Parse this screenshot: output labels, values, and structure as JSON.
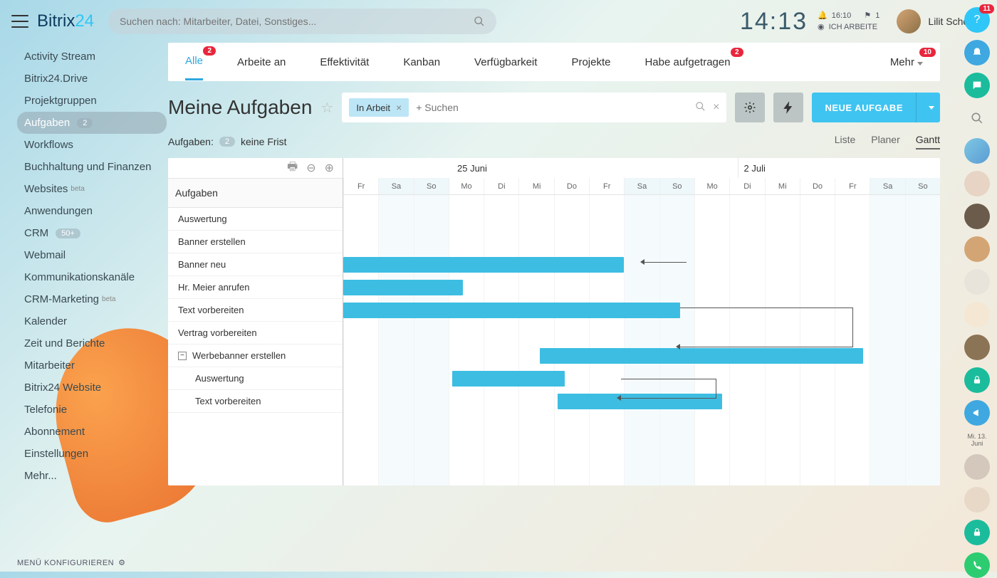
{
  "logo": {
    "part1": "Bitrix",
    "part2": "24"
  },
  "search": {
    "placeholder": "Suchen nach: Mitarbeiter, Datei, Sonstiges..."
  },
  "clock": "14:13",
  "mini": {
    "bell_time": "16:10",
    "flag_count": "1",
    "status": "ICH ARBEITE"
  },
  "user": {
    "name": "Lilit Schoo"
  },
  "sidebar": {
    "items": [
      {
        "label": "Activity Stream"
      },
      {
        "label": "Bitrix24.Drive"
      },
      {
        "label": "Projektgruppen"
      },
      {
        "label": "Aufgaben",
        "active": true,
        "pill": "2"
      },
      {
        "label": "Workflows"
      },
      {
        "label": "Buchhaltung und Finanzen"
      },
      {
        "label": "Websites",
        "beta": "beta"
      },
      {
        "label": "Anwendungen"
      },
      {
        "label": "CRM",
        "pill": "50+"
      },
      {
        "label": "Webmail"
      },
      {
        "label": "Kommunikationskanäle"
      },
      {
        "label": "CRM-Marketing",
        "beta": "beta"
      },
      {
        "label": "Kalender"
      },
      {
        "label": "Zeit und Berichte"
      },
      {
        "label": "Mitarbeiter"
      },
      {
        "label": "Bitrix24 Website"
      },
      {
        "label": "Telefonie"
      },
      {
        "label": "Abonnement"
      },
      {
        "label": "Einstellungen"
      },
      {
        "label": "Mehr..."
      }
    ],
    "footer": "MENÜ KONFIGURIEREN"
  },
  "tabs": {
    "items": [
      {
        "label": "Alle",
        "active": true,
        "badge": "2"
      },
      {
        "label": "Arbeite an"
      },
      {
        "label": "Effektivität"
      },
      {
        "label": "Kanban"
      },
      {
        "label": "Verfügbarkeit"
      },
      {
        "label": "Projekte"
      },
      {
        "label": "Habe aufgetragen",
        "badge": "2"
      }
    ],
    "more": {
      "label": "Mehr",
      "badge": "10"
    }
  },
  "page": {
    "title": "Meine Aufgaben"
  },
  "filter": {
    "chip": "In Arbeit",
    "placeholder": "+ Suchen"
  },
  "new_task_button": "NEUE AUFGABE",
  "sub": {
    "prefix": "Aufgaben:",
    "count": "2",
    "suffix": "keine Frist"
  },
  "views": {
    "list": "Liste",
    "planner": "Planer",
    "gantt": "Gantt"
  },
  "gantt": {
    "header": "Aufgaben",
    "months": [
      {
        "label": "25 Juni",
        "span": 10
      },
      {
        "label": "2 Juli",
        "span": 7
      }
    ],
    "days": [
      "Fr",
      "Sa",
      "So",
      "Mo",
      "Di",
      "Mi",
      "Do",
      "Fr",
      "Sa",
      "So",
      "Mo",
      "Di",
      "Mi",
      "Do",
      "Fr",
      "Sa",
      "So"
    ],
    "weekend": [
      1,
      2,
      8,
      9,
      15,
      16
    ],
    "tasks": [
      {
        "label": "Auswertung"
      },
      {
        "label": "Banner erstellen"
      },
      {
        "label": "Banner neu",
        "bar": {
          "start": 0,
          "span": 8
        }
      },
      {
        "label": "Hr. Meier anrufen",
        "bar": {
          "start": 0,
          "span": 3.4
        }
      },
      {
        "label": "Text vorbereiten",
        "bar": {
          "start": 0,
          "span": 9.6
        }
      },
      {
        "label": "Vertrag vorbereiten"
      },
      {
        "label": "Werbebanner erstellen",
        "expandable": true,
        "bar": {
          "start": 5.6,
          "span": 9.2
        }
      },
      {
        "label": "Auswertung",
        "sub": true,
        "bar": {
          "start": 3.1,
          "span": 3.2
        }
      },
      {
        "label": "Text vorbereiten",
        "sub": true,
        "bar": {
          "start": 6.1,
          "span": 4.7
        }
      }
    ]
  },
  "rail": {
    "help_badge": "11",
    "date": "Mi. 13. Juni"
  }
}
